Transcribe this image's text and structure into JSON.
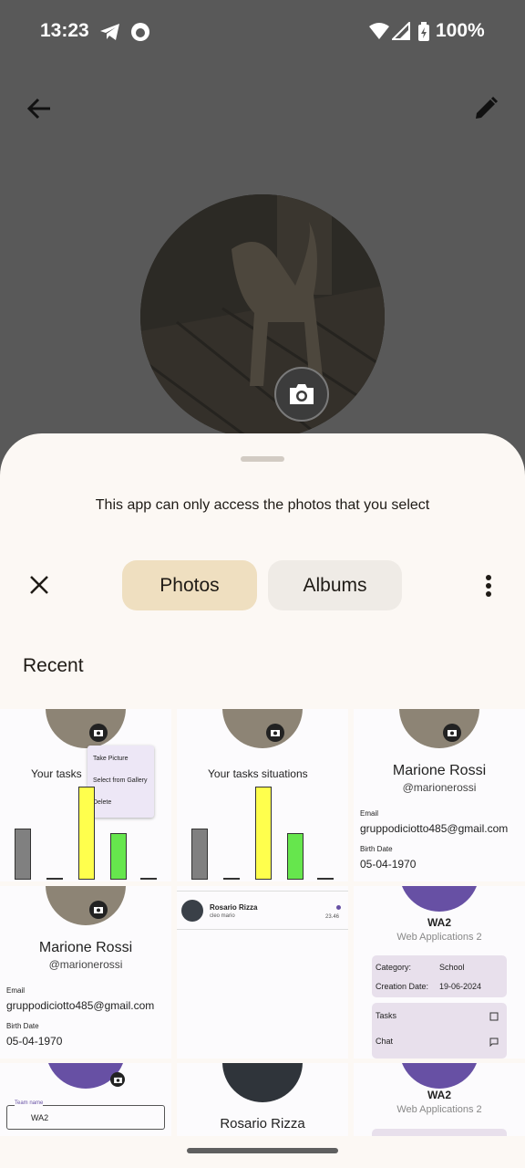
{
  "status_bar": {
    "time": "13:23",
    "battery": "100%"
  },
  "top_bar": {
    "back_icon": "arrow-left-icon",
    "edit_icon": "pencil-icon"
  },
  "picker": {
    "notice": "This app can only access the photos that you select",
    "tabs": [
      {
        "label": "Photos",
        "selected": true
      },
      {
        "label": "Albums",
        "selected": false
      }
    ],
    "section_title": "Recent",
    "colors": {
      "selected_tab": "#efdfc0",
      "sheet_bg": "#fcf8f4",
      "accent": "#6750a4"
    }
  },
  "thumbnails": {
    "t1": {
      "title": "Your tasks",
      "menu": [
        "Take Picture",
        "Select from Gallery",
        "Delete"
      ]
    },
    "t2": {
      "title": "Your tasks situations"
    },
    "t3": {
      "name": "Marione Rossi",
      "username": "@marionerossi",
      "email_label": "Email",
      "email": "gruppodiciotto485@gmail.com",
      "birth_label": "Birth Date",
      "birth": "05-04-1970"
    },
    "t4": {
      "name": "Marione Rossi",
      "username": "@marionerossi",
      "email_label": "Email",
      "email": "gruppodiciotto485@gmail.com",
      "birth_label": "Birth Date",
      "birth": "05-04-1970"
    },
    "t5": {
      "name": "Rosario Rizza",
      "subtitle": "cleo mario",
      "time": "23.46"
    },
    "t6": {
      "team": "WA2",
      "subtitle": "Web Applications 2",
      "category_label": "Category:",
      "category": "School",
      "creation_label": "Creation Date:",
      "creation": "19-06-2024",
      "tasks": "Tasks",
      "chat": "Chat"
    },
    "t7": {
      "field_label": "Team name",
      "value": "WA2"
    },
    "t8": {
      "name": "Rosario Rizza"
    },
    "t9": {
      "team": "WA2",
      "subtitle": "Web Applications 2"
    }
  },
  "chart_bars": {
    "colors": [
      "#808080",
      "#ffff4d",
      "#66e64d"
    ],
    "heights": [
      0.55,
      0.02,
      1.0,
      0.5,
      0.02
    ]
  }
}
